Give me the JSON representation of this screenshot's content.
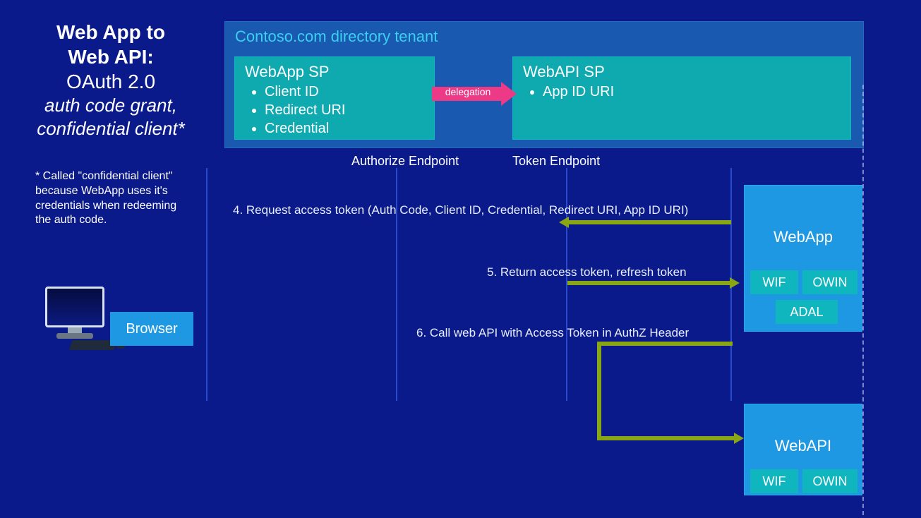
{
  "title": {
    "line1": "Web App to",
    "line2": "Web API:",
    "line3": "OAuth 2.0",
    "line4": "auth code grant,",
    "line5": "confidential client*"
  },
  "footnote": "* Called \"confidential client\" because WebApp uses it's credentials when redeeming the auth code.",
  "tenant": {
    "title": "Contoso.com directory tenant",
    "webapp_sp": {
      "title": "WebApp SP",
      "items": [
        "Client ID",
        "Redirect URI",
        "Credential"
      ]
    },
    "webapi_sp": {
      "title": "WebAPI SP",
      "items": [
        "App ID URI"
      ]
    },
    "delegation_label": "delegation"
  },
  "endpoints": {
    "authorize": "Authorize Endpoint",
    "token": "Token Endpoint"
  },
  "actors": {
    "browser": "Browser",
    "webapp": "WebApp",
    "webapi": "WebAPI"
  },
  "chips": {
    "wif": "WIF",
    "owin": "OWIN",
    "adal": "ADAL"
  },
  "steps": {
    "s4": "4. Request access token (Auth Code, Client ID, Credential, Redirect URI, App ID URI)",
    "s5": "5. Return access token, refresh token",
    "s6": "6. Call web API with Access Token in AuthZ Header"
  }
}
